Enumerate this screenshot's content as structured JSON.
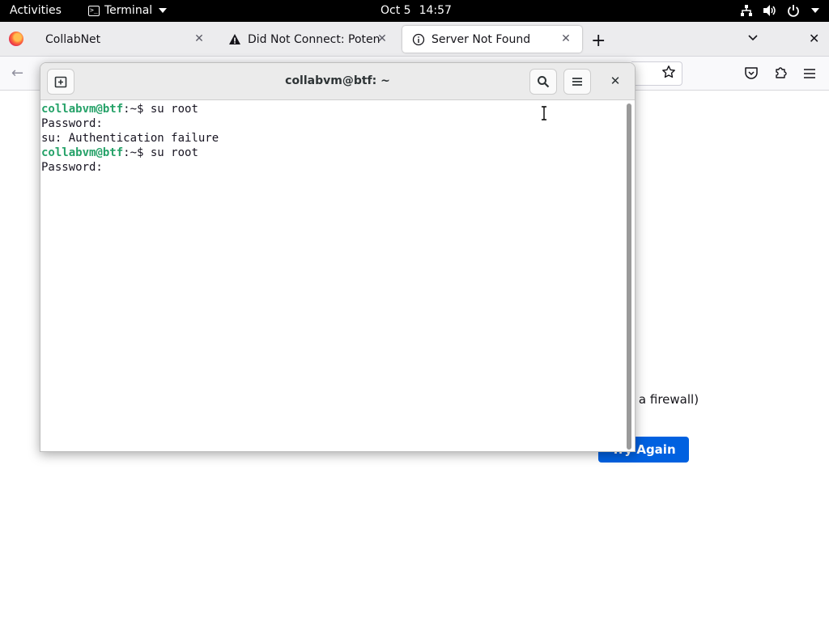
{
  "topbar": {
    "activities": "Activities",
    "app_name": "Terminal",
    "date": "Oct 5",
    "time": "14:57",
    "tray_icons": [
      "network-icon",
      "volume-icon",
      "power-icon"
    ]
  },
  "browser": {
    "tabs": [
      {
        "title": "CollabNet",
        "icon": "none",
        "active": false
      },
      {
        "title": "Did Not Connect: Potenti",
        "icon": "warning-icon",
        "active": false
      },
      {
        "title": "Server Not Found",
        "icon": "info-icon",
        "active": true
      }
    ],
    "page": {
      "partial_text": "l a firewall)",
      "button_partial": "Try Again"
    }
  },
  "terminal": {
    "title": "collabvm@btf: ~",
    "lines": [
      {
        "user": "collabvm@btf",
        "rest": ":~$ su root"
      },
      {
        "user": "",
        "rest": "Password:"
      },
      {
        "user": "",
        "rest": "su: Authentication failure"
      },
      {
        "user": "collabvm@btf",
        "rest": ":~$ su root"
      },
      {
        "user": "",
        "rest": "Password:"
      }
    ]
  },
  "colors": {
    "prompt_green": "#26a269",
    "firefox_blue": "#0061e0",
    "topbar_bg": "#000000"
  }
}
